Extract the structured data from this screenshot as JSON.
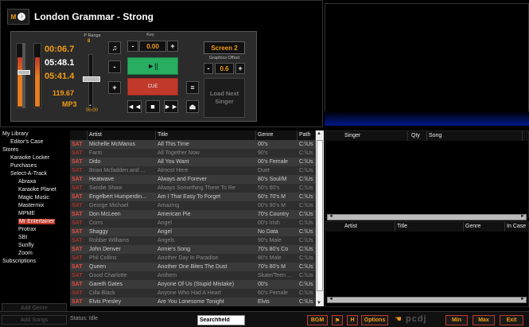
{
  "now_playing": {
    "logo_letter": "M",
    "title": "London Grammar - Strong"
  },
  "player": {
    "elapsed": "00:06.7",
    "total": "05:48.1",
    "remaining": "05:41.4",
    "bpm": "119.67",
    "format": "MP3",
    "p_range_label": "P Range",
    "p_range_value": "8",
    "pitch_value": "00.00",
    "key_label": "Key",
    "key_value": "0.00",
    "play_label": "►||",
    "cue_label": "CUE",
    "plus": "+",
    "minus": "-",
    "screen_label": "Screen 2",
    "graphics_offset_label": "Graphics Offset",
    "graphics_offset_value": "0.6",
    "load_next_label": "Load Next Singer",
    "volume_level": 0.78
  },
  "sidebar": {
    "items": [
      {
        "label": "My Library",
        "level": 0
      },
      {
        "label": "Editor's Case",
        "level": 1
      },
      {
        "label": "Stores",
        "level": 0
      },
      {
        "label": "Karaoke Locker",
        "level": 1
      },
      {
        "label": "Purchases",
        "level": 1
      },
      {
        "label": "Select-A-Track",
        "level": 1
      },
      {
        "label": "Abraxa",
        "level": 2
      },
      {
        "label": "Karaoke Planet",
        "level": 2
      },
      {
        "label": "Magic Music",
        "level": 2
      },
      {
        "label": "Mastermix",
        "level": 2
      },
      {
        "label": "MPME",
        "level": 2
      },
      {
        "label": "Mr Entertainer",
        "level": 2,
        "selected": true
      },
      {
        "label": "Protrax",
        "level": 2
      },
      {
        "label": "SBI",
        "level": 2
      },
      {
        "label": "Sunfly",
        "level": 2
      },
      {
        "label": "Zoom",
        "level": 2
      },
      {
        "label": "Subscriptions",
        "level": 0
      }
    ],
    "add_genre": "Add Genre",
    "add_songs": "Add Songs"
  },
  "table": {
    "columns": [
      "",
      "Artist",
      "Title",
      "Genre",
      "Path"
    ],
    "rows": [
      {
        "tag": "SAT",
        "artist": "Michelle McManus",
        "title": "All This Time",
        "genre": "00's",
        "path": "C:\\Us",
        "dim": false
      },
      {
        "tag": "SAT",
        "artist": "Farm",
        "title": "All Together Now",
        "genre": "90's",
        "path": "C:\\Us",
        "dim": true
      },
      {
        "tag": "SAT",
        "artist": "Dido",
        "title": "All You Want",
        "genre": "00's Female",
        "path": "C:\\Us",
        "dim": false
      },
      {
        "tag": "SAT",
        "artist": "Brian Mcfadden and ...",
        "title": "Almost Here",
        "genre": "Duet",
        "path": "C:\\Us",
        "dim": true
      },
      {
        "tag": "SAT",
        "artist": "Heatwave",
        "title": "Always and Forever",
        "genre": "80's Soul/M",
        "path": "C:\\Us",
        "dim": false
      },
      {
        "tag": "SAT",
        "artist": "Sandie Shaw",
        "title": "Always Something There To Re",
        "genre": "50's 60's",
        "path": "C:\\Us",
        "dim": true
      },
      {
        "tag": "SAT",
        "artist": "Engelbert Humperdin...",
        "title": "Am I That Easy To Forget",
        "genre": "60's 70's M",
        "path": "C:\\Us",
        "dim": false
      },
      {
        "tag": "SAT",
        "artist": "George Michael",
        "title": "Amazing",
        "genre": "00's 90's M",
        "path": "C:\\Us",
        "dim": true
      },
      {
        "tag": "SAT",
        "artist": "Don McLeen",
        "title": "American Pie",
        "genre": "70's Country",
        "path": "C:\\Us",
        "dim": false
      },
      {
        "tag": "SAT",
        "artist": "Corrs",
        "title": "Angel",
        "genre": "00's Irish",
        "path": "C:\\Us",
        "dim": true
      },
      {
        "tag": "SAT",
        "artist": "Shaggy",
        "title": "Angel",
        "genre": "No Data",
        "path": "C:\\Us",
        "dim": false
      },
      {
        "tag": "SAT",
        "artist": "Robbie Williams",
        "title": "Angels",
        "genre": "90's Male",
        "path": "C:\\Us",
        "dim": true
      },
      {
        "tag": "SAT",
        "artist": "John Denver",
        "title": "Annie's Song",
        "genre": "70's 80's Co",
        "path": "C:\\Us",
        "dim": false
      },
      {
        "tag": "SAT",
        "artist": "Phil Collins",
        "title": "Another Day In Paradise",
        "genre": "80's Male",
        "path": "C:\\Us",
        "dim": true
      },
      {
        "tag": "SAT",
        "artist": "Queen",
        "title": "Another One Bites The Dust",
        "genre": "70's 80's M",
        "path": "C:\\Us",
        "dim": false
      },
      {
        "tag": "SAT",
        "artist": "Good Charlotte",
        "title": "Anthem",
        "genre": "Skate/Teen ...",
        "path": "C:\\Us",
        "dim": true
      },
      {
        "tag": "SAT",
        "artist": "Gareth Gates",
        "title": "Anyone Of Us (Stupid Mistake)",
        "genre": "00's",
        "path": "C:\\Us",
        "dim": false
      },
      {
        "tag": "SAT",
        "artist": "Cilla Black",
        "title": "Anyone Who Had A Heart",
        "genre": "60's Female",
        "path": "C:\\Us",
        "dim": true
      },
      {
        "tag": "SAT",
        "artist": "Elvis Presley",
        "title": "Are You Lonesome Tonight",
        "genre": "Elvis",
        "path": "C:\\Us",
        "dim": false
      }
    ]
  },
  "singer_panel": {
    "columns": [
      "Singer",
      "Qty",
      "Song"
    ]
  },
  "history_panel": {
    "columns": [
      "Artist",
      "Title",
      "Genre",
      "In Case"
    ]
  },
  "bottom": {
    "status": "Status: Idle",
    "search_placeholder": "Searchfield",
    "bgm": "BGM",
    "h": "H",
    "options": "Options",
    "brand": "pcdj",
    "min": "Min",
    "max": "Max",
    "exit": "Exit"
  }
}
